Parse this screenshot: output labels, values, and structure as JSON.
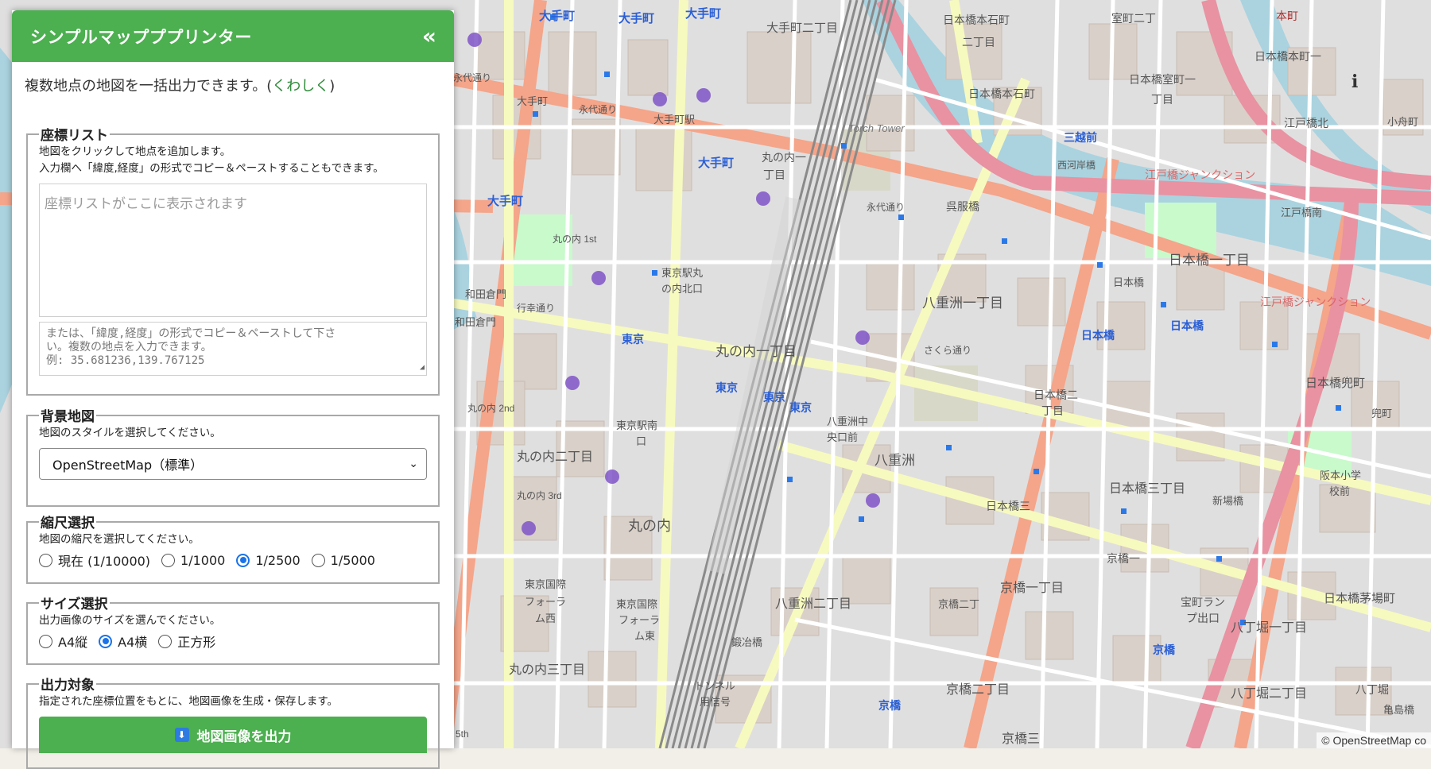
{
  "panel": {
    "title": "シンプルマップププリンター",
    "collapse_label": "«",
    "intro_text": "複数地点の地図を一括出力できます。(",
    "intro_link": "くわしく",
    "intro_close": ")"
  },
  "coords": {
    "legend": "座標リスト",
    "desc1": "地図をクリックして地点を追加します。",
    "desc2": "入力欄へ「緯度,経度」の形式でコピー＆ペーストすることもできます。",
    "list_placeholder": "座標リストがここに表示されます",
    "paste_line1": "または、「緯度,経度」の形式でコピー＆ペーストして下さ",
    "paste_line2": "い。複数の地点を入力できます。",
    "paste_line3": "例: 35.681236,139.767125"
  },
  "background": {
    "legend": "背景地図",
    "desc": "地図のスタイルを選択してください。",
    "selected": "OpenStreetMap（標準）"
  },
  "scale": {
    "legend": "縮尺選択",
    "desc": "地図の縮尺を選択してください。",
    "options": [
      "現在 (1/10000)",
      "1/1000",
      "1/2500",
      "1/5000"
    ],
    "selected_index": 2
  },
  "size": {
    "legend": "サイズ選択",
    "desc": "出力画像のサイズを選んでください。",
    "options": [
      "A4縦",
      "A4横",
      "正方形"
    ],
    "selected_index": 1
  },
  "output": {
    "legend": "出力対象",
    "desc": "指定された座標位置をもとに、地図画像を生成・保存します。",
    "button_label": "地図画像を出力",
    "button_icon": "download-icon"
  },
  "map": {
    "attribution": "© OpenStreetMap co",
    "labels": {
      "l1": "大手町",
      "l2": "大手町",
      "l3": "大手町",
      "l4": "大手町二丁目",
      "l5": "日本橋本石町",
      "l6": "二丁目",
      "l7": "室町二丁",
      "l8": "本町",
      "l9": "日本橋本町一",
      "l10": "永代通り",
      "l11": "大手町",
      "l12": "永代通り",
      "l13": "大手町駅",
      "l14": "日本橋本石町",
      "l15": "日本橋室町一",
      "l16": "丁目",
      "l17": "三越前",
      "l18": "西河岸橋",
      "l19": "江戸橋ジャンクション",
      "l20": "江戸橋北",
      "l21": "Torch Tower",
      "l22": "大手町",
      "l23": "丸の内一",
      "l24": "丁目",
      "l25": "永代通り",
      "l26": "呉服橋",
      "l27": "大手町",
      "l28": "丸の内 1st",
      "l29": "東京駅丸",
      "l30": "の内北口",
      "l31": "和田倉門",
      "l32": "行幸通り",
      "l33": "和田倉門",
      "l34": "東京",
      "l35": "丸の内一丁目",
      "l36": "八重洲一丁目",
      "l37": "日本橋一丁目",
      "l38": "日本橋",
      "l39": "日本橋",
      "l40": "日本橋",
      "l41": "江戸橋ジャンクション",
      "l42": "東京",
      "l43": "東京",
      "l44": "東京",
      "l45": "さくら通り",
      "l46": "日本橋二",
      "l47": "丁目",
      "l48": "日本橋兜町",
      "l49": "東京駅南",
      "l50": "口",
      "l51": "八重洲中",
      "l52": "央口前",
      "l53": "八重洲",
      "l54": "丸の内二丁目",
      "l55": "丸の内 2nd",
      "l56": "丸の内 3rd",
      "l57": "丸の内",
      "l58": "日本橋三丁目",
      "l59": "日本橋三",
      "l60": "新場橋",
      "l61": "阪本小学",
      "l62": "校前",
      "l63": "東京国際",
      "l64": "フォーラ",
      "l65": "ム西",
      "l66": "東京国際",
      "l67": "フォーラ",
      "l68": "ム東",
      "l69": "京橋一丁目",
      "l70": "京橋一",
      "l71": "八重洲二丁目",
      "l72": "京橋二丁",
      "l73": "宝町ラン",
      "l74": "プ出口",
      "l75": "八丁堀一丁目",
      "l76": "日本橋茅場町",
      "l77": "丸の内三丁目",
      "l78": "鍛冶橋",
      "l79": "トンネル",
      "l80": "用信号",
      "l81": "京橋",
      "l82": "京橋二丁目",
      "l83": "京橋",
      "l84": "八丁堀二丁目",
      "l85": "八丁堀",
      "l86": "亀島橋",
      "l87": "京橋三",
      "l88": "5th",
      "l89": "小舟町",
      "l90": "江戸橋南",
      "l91": "兜町"
    }
  }
}
